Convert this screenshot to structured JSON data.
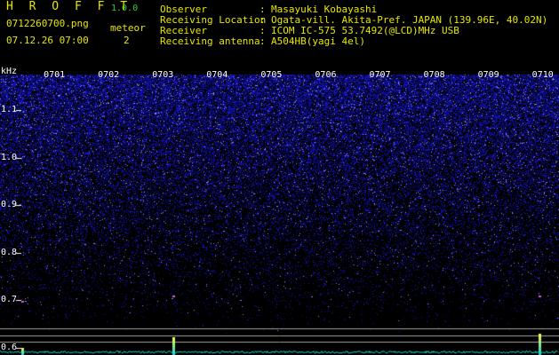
{
  "header": {
    "app_title": "H R O F F T",
    "app_version": "1.0.0",
    "filename": "0712260700.png",
    "meteor_label": "meteor",
    "datetime": "07.12.26 07:00",
    "meteor_count": "2",
    "info": [
      {
        "label": "Observer",
        "sep": ":",
        "value": "Masayuki Kobayashi"
      },
      {
        "label": "Receiving Location",
        "sep": ":",
        "value": "Ogata-vill. Akita-Pref. JAPAN (139.96E, 40.02N)"
      },
      {
        "label": "Receiver",
        "sep": ":",
        "value": "ICOM IC-575 53.7492(@LCD)MHz USB"
      },
      {
        "label": "Receiving antenna",
        "sep": ":",
        "value": "A504HB(yagi 4el)"
      }
    ]
  },
  "spectrogram": {
    "y_unit": "kHz",
    "y_ticks": [
      "1.1",
      "1.0",
      "0.9",
      "0.8",
      "0.7",
      "0.6"
    ],
    "y_tick_values": [
      1.1,
      1.0,
      0.9,
      0.8,
      0.7,
      0.6
    ],
    "y_range": [
      0.585,
      1.19
    ],
    "x_ticks": [
      "0701",
      "0702",
      "0703",
      "0704",
      "0705",
      "0706",
      "0707",
      "0708",
      "0709",
      "0710"
    ],
    "x_tick_values": [
      1,
      2,
      3,
      4,
      5,
      6,
      7,
      8,
      9,
      10
    ],
    "x_range": [
      0,
      10.3
    ],
    "colors": {
      "noise": "#3030c8",
      "noise_bright": "#8a8aff",
      "signal": "#ffff50",
      "baseline": "#20d0d0",
      "marker": "#d060d0",
      "ref_line": "#a0a0a0",
      "text_header_yellow": "#e6e600",
      "text_header_green": "#37c837"
    }
  }
}
